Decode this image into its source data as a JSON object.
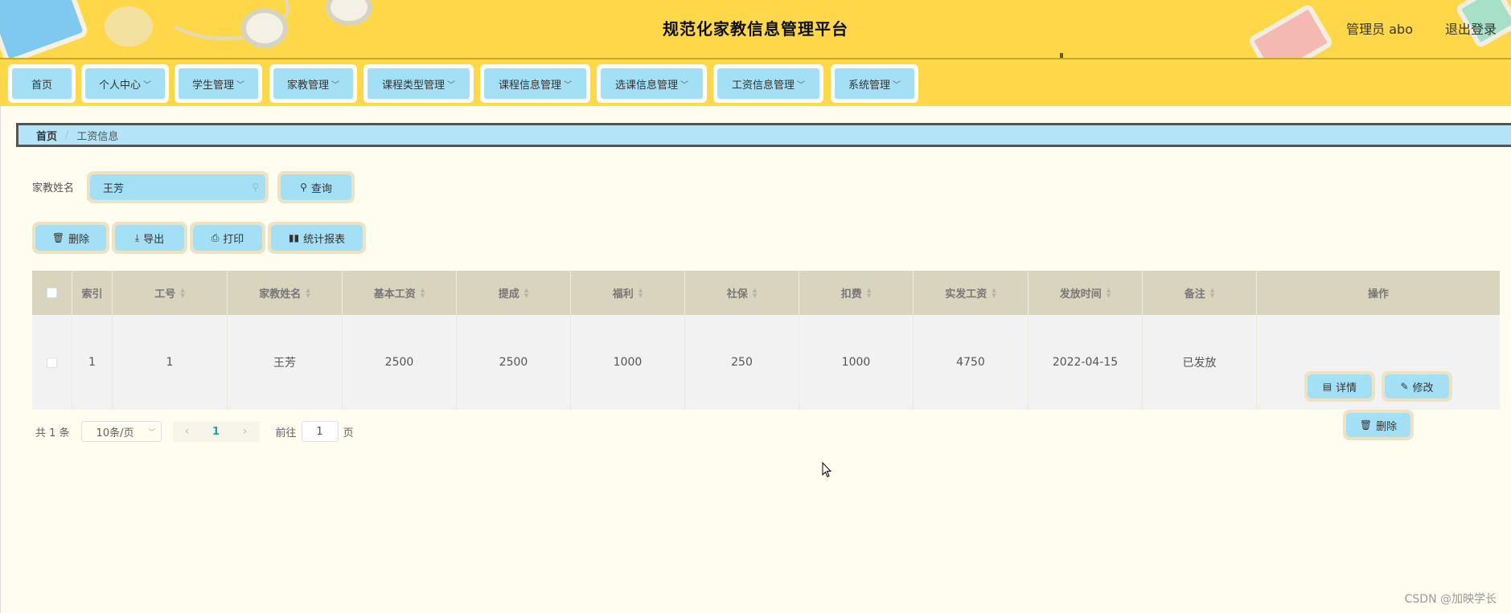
{
  "header": {
    "title": "规范化家教信息管理平台",
    "admin_label": "管理员 abo",
    "logout_label": "退出登录"
  },
  "nav": {
    "items": [
      {
        "label": "首页",
        "dropdown": false
      },
      {
        "label": "个人中心",
        "dropdown": true
      },
      {
        "label": "学生管理",
        "dropdown": true
      },
      {
        "label": "家教管理",
        "dropdown": true
      },
      {
        "label": "课程类型管理",
        "dropdown": true
      },
      {
        "label": "课程信息管理",
        "dropdown": true
      },
      {
        "label": "选课信息管理",
        "dropdown": true
      },
      {
        "label": "工资信息管理",
        "dropdown": true
      },
      {
        "label": "系统管理",
        "dropdown": true
      }
    ]
  },
  "breadcrumb": {
    "home": "首页",
    "separator": "/",
    "current": "工资信息"
  },
  "search": {
    "label": "家教姓名",
    "value": "王芳",
    "query_button": "查询"
  },
  "actions": {
    "delete": "删除",
    "export": "导出",
    "print": "打印",
    "report": "统计报表"
  },
  "table": {
    "headers": [
      "索引",
      "工号",
      "家教姓名",
      "基本工资",
      "提成",
      "福利",
      "社保",
      "扣费",
      "实发工资",
      "发放时间",
      "备注",
      "操作"
    ],
    "rows": [
      {
        "index": "1",
        "job_no": "1",
        "name": "王芳",
        "base_salary": "2500",
        "commission": "2500",
        "welfare": "1000",
        "social_security": "250",
        "deduction": "1000",
        "net_salary": "4750",
        "pay_date": "2022-04-15",
        "remark": "已发放"
      }
    ],
    "row_actions": {
      "detail": "详情",
      "edit": "修改",
      "delete": "删除"
    }
  },
  "pagination": {
    "total": "共 1 条",
    "page_size": "10条/页",
    "current_page": "1",
    "goto_prefix": "前往",
    "goto_value": "1",
    "goto_suffix": "页"
  },
  "watermark": "CSDN @加映学长",
  "colors": {
    "header_bg": "#ffd84a",
    "button_bg": "#a3e0f6",
    "page_bg": "#fffdef",
    "table_head_bg": "#d9d4bd"
  }
}
